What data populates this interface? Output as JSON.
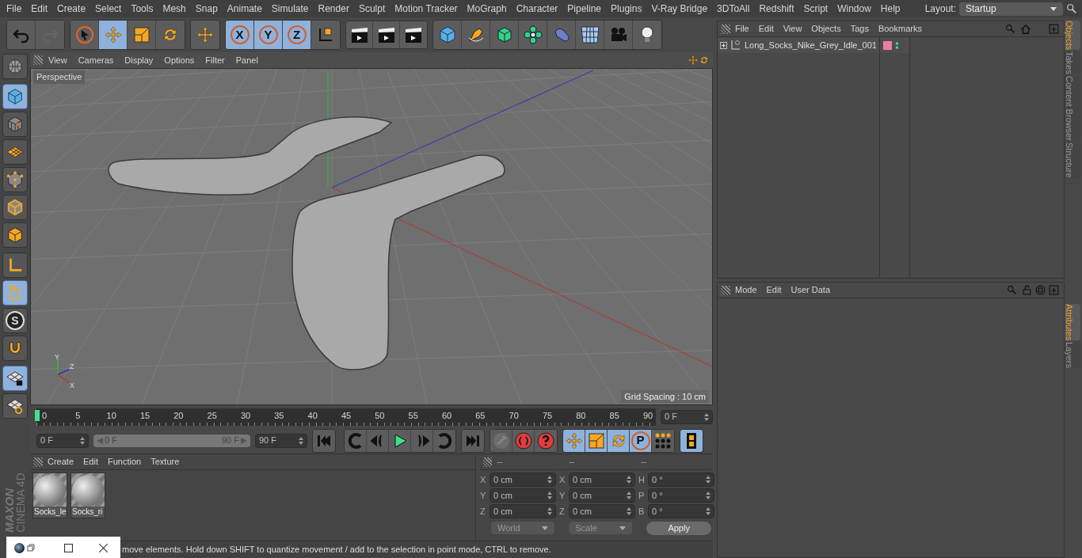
{
  "menu_bar": [
    "File",
    "Edit",
    "Create",
    "Select",
    "Tools",
    "Mesh",
    "Snap",
    "Animate",
    "Simulate",
    "Render",
    "Sculpt",
    "Motion Tracker",
    "MoGraph",
    "Character",
    "Pipeline",
    "Plugins",
    "V-Ray Bridge",
    "3DToAll",
    "Redshift",
    "Script",
    "Window",
    "Help"
  ],
  "layout": {
    "label": "Layout:",
    "value": "Startup"
  },
  "toolbar": [
    [
      {
        "kind": "undo",
        "selected": false,
        "disabled": false
      },
      {
        "kind": "redo",
        "selected": false,
        "disabled": true
      }
    ],
    [
      {
        "kind": "select",
        "selected": false,
        "disabled": false
      },
      {
        "kind": "move",
        "selected": true,
        "disabled": false
      },
      {
        "kind": "scale",
        "selected": false,
        "disabled": false
      },
      {
        "kind": "rotate",
        "selected": false,
        "disabled": false
      }
    ],
    [
      {
        "kind": "move",
        "selected": false,
        "disabled": false
      }
    ],
    [
      {
        "kind": "letter",
        "label": "X",
        "selected": true,
        "disabled": false
      },
      {
        "kind": "letter",
        "label": "Y",
        "selected": true,
        "disabled": false
      },
      {
        "kind": "letter",
        "label": "Z",
        "selected": true,
        "disabled": false
      },
      {
        "kind": "coord",
        "selected": false,
        "disabled": false
      }
    ],
    [
      {
        "kind": "clapper",
        "selected": false,
        "disabled": false
      },
      {
        "kind": "clapper",
        "selected": false,
        "disabled": false
      },
      {
        "kind": "clapper",
        "selected": false,
        "disabled": false
      }
    ],
    [
      {
        "kind": "cube",
        "selected": false,
        "disabled": false
      },
      {
        "kind": "pen",
        "selected": false,
        "disabled": false
      },
      {
        "kind": "greencube",
        "selected": false,
        "disabled": false
      },
      {
        "kind": "flower",
        "selected": false,
        "disabled": false
      },
      {
        "kind": "bent",
        "selected": false,
        "disabled": false
      },
      {
        "kind": "floor",
        "selected": false,
        "disabled": false
      },
      {
        "kind": "camera",
        "selected": false,
        "disabled": false
      },
      {
        "kind": "bulb",
        "selected": false,
        "disabled": false
      }
    ]
  ],
  "left_tools": [
    [
      {
        "kind": "globe",
        "selected": false
      }
    ],
    [
      {
        "kind": "cube",
        "selected": true
      },
      {
        "kind": "texture",
        "selected": false
      },
      {
        "kind": "plane",
        "selected": false
      },
      {
        "kind": "points",
        "selected": false
      },
      {
        "kind": "edges",
        "selected": false
      },
      {
        "kind": "faces",
        "selected": false
      }
    ],
    [
      {
        "kind": "axis",
        "selected": false
      },
      {
        "kind": "mouse",
        "selected": true
      },
      {
        "kind": "letter",
        "label": "S",
        "selected": false
      },
      {
        "kind": "magnet",
        "selected": false
      }
    ],
    [
      {
        "kind": "gridlock",
        "selected": true
      },
      {
        "kind": "gridrotate",
        "selected": false
      }
    ]
  ],
  "logo": {
    "brand": "MAXON",
    "product": "CINEMA 4D"
  },
  "viewport": {
    "menu": [
      "View",
      "Cameras",
      "Display",
      "Options",
      "Filter",
      "Panel"
    ],
    "camera": "Perspective",
    "grid_spacing": "Grid Spacing : 10 cm",
    "gizmo_labels": [
      "Y",
      "Z",
      "X"
    ]
  },
  "timeline": {
    "ticks": [
      "0",
      "5",
      "10",
      "15",
      "20",
      "25",
      "30",
      "35",
      "40",
      "45",
      "50",
      "55",
      "60",
      "65",
      "70",
      "75",
      "80",
      "85",
      "90"
    ],
    "playhead": {
      "level": 0
    },
    "current_frame": "0 F",
    "start": "0 F",
    "range_start": "0 F",
    "range_end": "90 F",
    "range": {
      "level": 1
    },
    "end": "90 F",
    "buttons": [
      [
        {
          "kind": "first",
          "selected": false,
          "disabled": false
        }
      ],
      [
        {
          "kind": "loopback",
          "selected": false,
          "disabled": false
        },
        {
          "kind": "stepback",
          "selected": false,
          "disabled": false
        },
        {
          "kind": "play",
          "selected": false,
          "disabled": false
        },
        {
          "kind": "stepfwd",
          "selected": false,
          "disabled": false
        },
        {
          "kind": "loopfwd",
          "selected": false,
          "disabled": false
        }
      ],
      [
        {
          "kind": "last",
          "selected": false,
          "disabled": false
        }
      ],
      [
        {
          "kind": "key",
          "selected": false,
          "disabled": true
        },
        {
          "kind": "record",
          "selected": false,
          "disabled": false
        },
        {
          "kind": "question",
          "selected": false,
          "disabled": false
        }
      ],
      [
        {
          "kind": "move",
          "selected": true,
          "disabled": false
        },
        {
          "kind": "scale",
          "selected": true,
          "disabled": false
        },
        {
          "kind": "rotate",
          "selected": true,
          "disabled": false
        },
        {
          "kind": "letter",
          "label": "P",
          "selected": true,
          "disabled": false
        },
        {
          "kind": "dots",
          "selected": false,
          "disabled": false
        }
      ],
      [
        {
          "kind": "film",
          "selected": true,
          "disabled": false
        }
      ]
    ]
  },
  "materials": {
    "menu": [
      "Create",
      "Edit",
      "Function",
      "Texture"
    ],
    "items": [
      "Socks_le",
      "Socks_ri"
    ]
  },
  "coordinates": {
    "headers": [
      "--",
      "--",
      "--"
    ],
    "rows": [
      [
        {
          "axis": "X",
          "value": "0 cm"
        },
        {
          "axis": "X",
          "value": "0 cm"
        },
        {
          "axis": "H",
          "value": "0 °"
        }
      ],
      [
        {
          "axis": "Y",
          "value": "0 cm"
        },
        {
          "axis": "Y",
          "value": "0 cm"
        },
        {
          "axis": "P",
          "value": "0 °"
        }
      ],
      [
        {
          "axis": "Z",
          "value": "0 cm"
        },
        {
          "axis": "Z",
          "value": "0 cm"
        },
        {
          "axis": "B",
          "value": "0 °"
        }
      ]
    ],
    "space": "World",
    "mode": "Scale",
    "apply": "Apply"
  },
  "status_bar": "move elements. Hold down SHIFT to quantize movement / add to the selection in point mode, CTRL to remove.",
  "objects": {
    "menu": [
      "File",
      "Edit",
      "View",
      "Objects",
      "Tags",
      "Bookmarks"
    ],
    "items": [
      {
        "name": "Long_Socks_Nike_Grey_Idle_001",
        "color": "#e87fa6",
        "expanded": false
      }
    ]
  },
  "attributes": {
    "menu": [
      "Mode",
      "Edit",
      "User Data"
    ]
  },
  "side_tabs_top": [
    {
      "label": "Objects",
      "selected": true
    },
    {
      "label": "Takes",
      "selected": false
    },
    {
      "label": "Content Browser",
      "selected": false
    },
    {
      "label": "Structure",
      "selected": false
    }
  ],
  "side_tabs_bottom": [
    {
      "label": "Attributes",
      "selected": true
    },
    {
      "label": "Layers",
      "selected": false
    }
  ]
}
